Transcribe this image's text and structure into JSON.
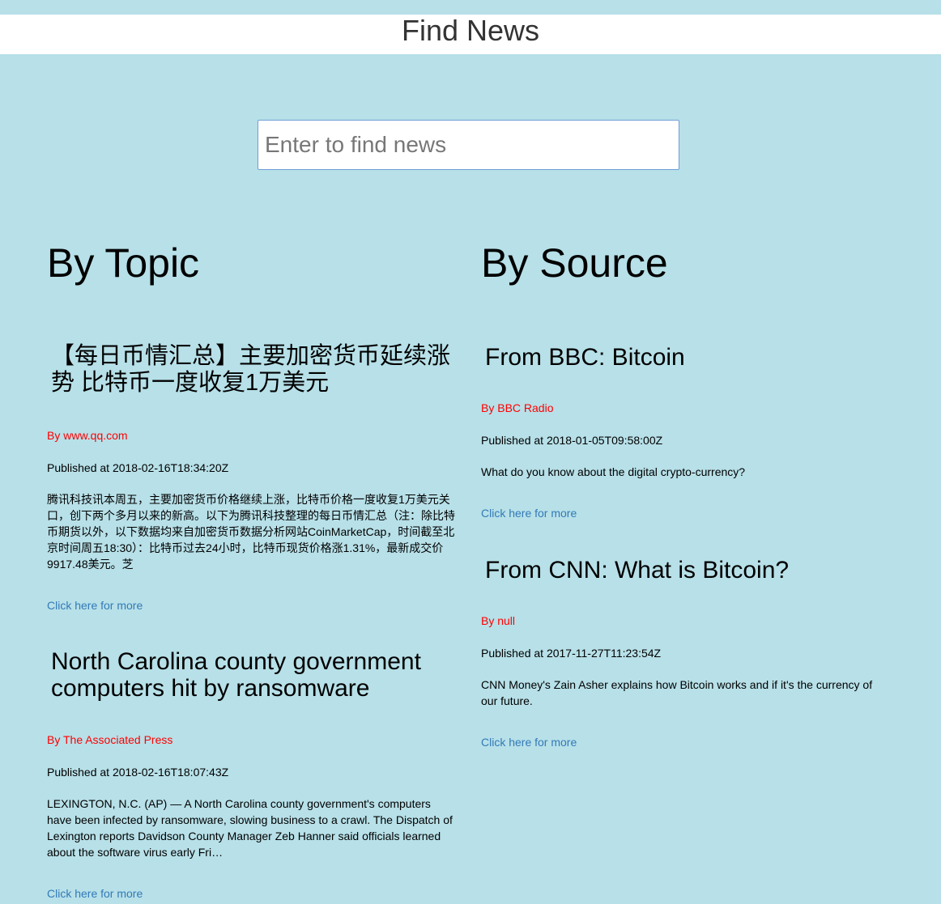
{
  "header": {
    "title": "Find News"
  },
  "search": {
    "placeholder": "Enter to find news",
    "value": ""
  },
  "topic": {
    "heading": "By Topic",
    "articles": [
      {
        "title": "【每日币情汇总】主要加密货币延续涨势 比特币一度收复1万美元",
        "byline": "By www.qq.com",
        "published": "Published at 2018-02-16T18:34:20Z",
        "description": "腾讯科技讯本周五，主要加密货币价格继续上涨，比特币价格一度收复1万美元关口，创下两个多月以来的新高。以下为腾讯科技整理的每日币情汇总（注：除比特币期货以外，以下数据均来自加密货币数据分析网站CoinMarketCap，时间截至北京时间周五18:30）：比特币过去24小时，比特币现货价格涨1.31%，最新成交价9917.48美元。芝",
        "more": "Click here for more"
      },
      {
        "title": "North Carolina county government computers hit by ransomware",
        "byline": "By The Associated Press",
        "published": "Published at 2018-02-16T18:07:43Z",
        "description": "LEXINGTON, N.C. (AP) — A North Carolina county government's computers have been infected by ransomware, slowing business to a crawl. The Dispatch of Lexington reports Davidson County Manager Zeb Hanner said officials learned about the software virus early Fri…",
        "more": "Click here for more"
      }
    ]
  },
  "source": {
    "heading": "By Source",
    "articles": [
      {
        "title": "From BBC: Bitcoin",
        "byline": "By BBC Radio",
        "published": "Published at 2018-01-05T09:58:00Z",
        "description": "What do you know about the digital crypto-currency?",
        "more": "Click here for more"
      },
      {
        "title": "From CNN: What is Bitcoin?",
        "byline": "By null",
        "published": "Published at 2017-11-27T11:23:54Z",
        "description": "CNN Money's Zain Asher explains how Bitcoin works and if it's the currency of our future.",
        "more": "Click here for more"
      }
    ]
  }
}
